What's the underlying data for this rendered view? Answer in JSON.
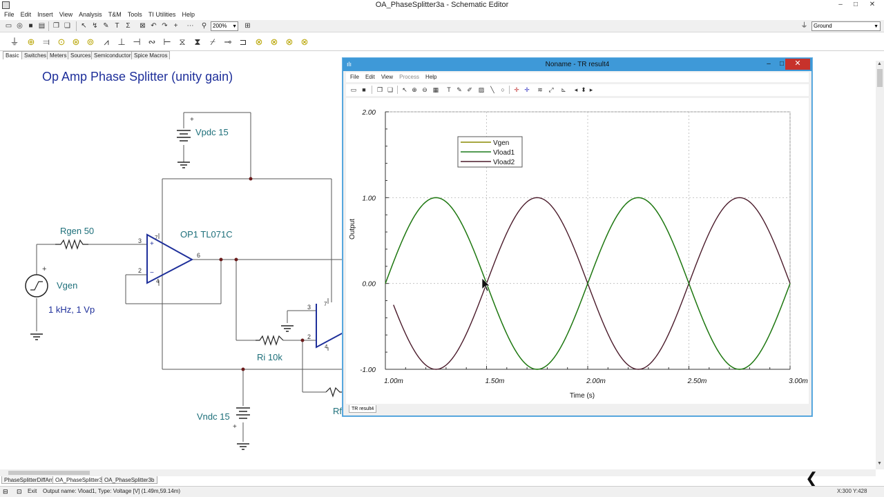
{
  "window": {
    "title": "OA_PhaseSplitter3a - Schematic Editor"
  },
  "menu": [
    "File",
    "Edit",
    "Insert",
    "View",
    "Analysis",
    "T&M",
    "Tools",
    "TI Utilities",
    "Help"
  ],
  "toolbar": {
    "zoom_value": "200%",
    "ground_value": "Ground"
  },
  "component_tabs": [
    "Basic",
    "Switches",
    "Meters",
    "Sources",
    "Semiconductors",
    "Spice Macros"
  ],
  "schematic": {
    "title": "Op Amp Phase Splitter (unity gain)",
    "labels": {
      "vpdc": "Vpdc 15",
      "vndc": "Vndc 15",
      "rgen": "Rgen 50",
      "vgen": "Vgen",
      "vgen_spec": "1 kHz, 1 Vp",
      "op1": "OP1 TL071C",
      "ri": "Ri 10k",
      "rf": "Rf",
      "pin3a": "3",
      "pin2a": "2",
      "pin6a": "6",
      "pin7a": "7",
      "pin4a": "4",
      "pin3b": "3",
      "pin2b": "2",
      "pin7b": "7",
      "pin4b": "4",
      "plus_sign": "+",
      "plus_in": "+",
      "minus_in": "−"
    }
  },
  "file_tabs": [
    "PhaseSplitterDiffAmp",
    "OA_PhaseSplitter3a",
    "OA_PhaseSplitter3b"
  ],
  "status": {
    "exit_label": "Exit",
    "text": "Output name: Vload1, Type: Voltage [V] (1.49m,59.14m)",
    "coords": "X:300 Y:428"
  },
  "result_window": {
    "title": "Noname - TR result4",
    "menu": [
      "File",
      "Edit",
      "View",
      "Process",
      "Help"
    ],
    "tab_label": "TR result4",
    "close_label": "✕",
    "min_label": "–",
    "max_label": "□"
  },
  "chart_data": {
    "type": "line",
    "title": "",
    "xlabel": "Time (s)",
    "ylabel": "Output",
    "xlim": [
      0.001,
      0.003
    ],
    "ylim": [
      -1.0,
      2.0
    ],
    "x_tick_labels": [
      "1.00m",
      "1.50m",
      "2.00m",
      "2.50m",
      "3.00m"
    ],
    "x_tick_values": [
      0.001,
      0.0015,
      0.002,
      0.0025,
      0.003
    ],
    "y_tick_labels": [
      "2.00",
      "1.00",
      "0.00",
      "-1.00"
    ],
    "y_tick_values": [
      2.0,
      1.0,
      0.0,
      -1.0
    ],
    "grid": true,
    "legend_position": "top-left",
    "series": [
      {
        "name": "Vgen",
        "color": "#8a8a00",
        "function": "sin",
        "frequency_hz": 1000,
        "amplitude": 1.0,
        "x_start": 0.001,
        "x_end": 0.003
      },
      {
        "name": "Vload1",
        "color": "#1a7a1a",
        "function": "sin",
        "frequency_hz": 1000,
        "amplitude": 1.0,
        "x_start": 0.001,
        "x_end": 0.003
      },
      {
        "name": "Vload2",
        "color": "#4a1a2a",
        "function": "-sin",
        "frequency_hz": 1000,
        "amplitude": 1.0,
        "x_start": 0.00104,
        "x_end": 0.003
      }
    ]
  }
}
